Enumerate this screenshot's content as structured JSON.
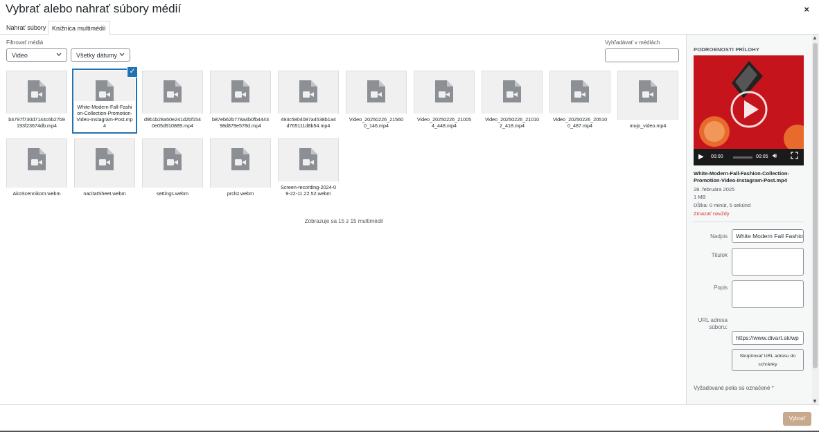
{
  "modal": {
    "title": "Vybrať alebo nahrať súbory médií",
    "close_symbol": "×"
  },
  "tabs": [
    {
      "label": "Nahrať súbory",
      "active": false
    },
    {
      "label": "Knižnica multimédií",
      "active": true
    }
  ],
  "filters": {
    "label": "Filtrovať médiá",
    "type_value": "Video",
    "date_value": "Všetky dátumy"
  },
  "search": {
    "label": "Vyhľadávať v médiách",
    "value": ""
  },
  "media_items": [
    {
      "filename": "b4797f730d7144c6b27b9193f23674db.mp4",
      "selected": false
    },
    {
      "filename": "White-Modern-Fall-Fashion-Collection-Promotion-Video-Instagram-Post.mp4",
      "selected": true
    },
    {
      "filename": "d9b1b28a50e241d2bf1540e05d910889.mp4",
      "selected": false
    },
    {
      "filename": "b87eb62b778a4b0fb444398d879e578d.mp4",
      "selected": false
    },
    {
      "filename": "493c5804087a4538b1a4d765111d8b54.mp4",
      "selected": false
    },
    {
      "filename": "Video_20250226_215600_146.mp4",
      "selected": false
    },
    {
      "filename": "Video_20250226_210054_448.mp4",
      "selected": false
    },
    {
      "filename": "Video_20250226_210102_418.mp4",
      "selected": false
    },
    {
      "filename": "Video_20250226_205100_487.mp4",
      "selected": false
    },
    {
      "filename": "mojo_video.mp4",
      "selected": false
    },
    {
      "filename": "AkoScennikom.webm",
      "selected": false
    },
    {
      "filename": "nacitatSheet.webm",
      "selected": false
    },
    {
      "filename": "settings.webm",
      "selected": false
    },
    {
      "filename": "prclst.webm",
      "selected": false
    },
    {
      "filename": "Screen-recording-2024-09-22-11.22.52.webm",
      "selected": false
    }
  ],
  "count_text": "Zobrazuje sa 15 z 15 multimédií",
  "details": {
    "heading": "Podrobnosti prílohy",
    "video_time_current": "00:00",
    "video_time_total": "00:05",
    "filename": "White-Modern-Fall-Fashion-Collection-Promotion-Video-Instagram-Post.mp4",
    "date": "28. februára 2025",
    "size": "1 MB",
    "duration": "Dĺžka: 0 minút, 5 sekúnd",
    "delete_link": "Zmazať navždy",
    "fields": {
      "title_label": "Nadpis",
      "title_value": "White Modern Fall Fashio",
      "caption_label": "Titulok",
      "description_label": "Popis",
      "url_label": "URL adresa súboru:",
      "url_value": "https://www.divart.sk/wp"
    },
    "copy_button": "Skopírovať URL adresu do schránky",
    "required_note": "Vyžadované polia sú označené",
    "required_star": "*"
  },
  "footer": {
    "select_button": "Vybrať"
  },
  "colors": {
    "accent": "#2271b1",
    "delete": "#d63638",
    "select_btn_disabled": "#c9a98d",
    "video_bg": "#c5141b"
  }
}
